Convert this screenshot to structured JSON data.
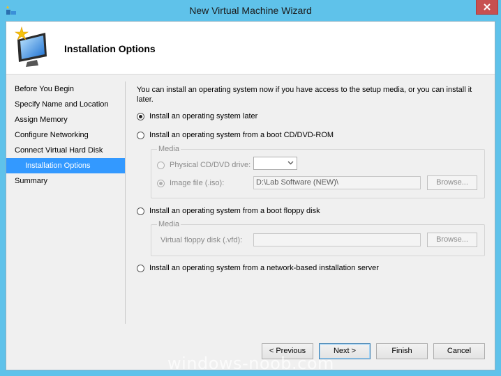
{
  "window": {
    "title": "New Virtual Machine Wizard",
    "icons": [
      "app-icon",
      "close-icon",
      "monitor-star-icon"
    ]
  },
  "header": {
    "title": "Installation Options"
  },
  "nav": {
    "items": [
      {
        "label": "Before You Begin",
        "selected": false
      },
      {
        "label": "Specify Name and Location",
        "selected": false
      },
      {
        "label": "Assign Memory",
        "selected": false
      },
      {
        "label": "Configure Networking",
        "selected": false
      },
      {
        "label": "Connect Virtual Hard Disk",
        "selected": false
      },
      {
        "label": "Installation Options",
        "selected": true
      },
      {
        "label": "Summary",
        "selected": false
      }
    ]
  },
  "content": {
    "intro_line1": "You can install an operating system now if you have access to the setup media, or you can install it",
    "intro_line2": "later.",
    "option_later": "Install an operating system later",
    "option_cd": "Install an operating system from a boot CD/DVD-ROM",
    "media_label": "Media",
    "physical_drive_label": "Physical CD/DVD drive:",
    "image_file_label": "Image file (.iso):",
    "image_file_value": "D:\\Lab Software (NEW)\\",
    "browse_label": "Browse...",
    "option_floppy": "Install an operating system from a boot floppy disk",
    "floppy_media_label": "Media",
    "floppy_disk_label": "Virtual floppy disk (.vfd):",
    "floppy_browse_label": "Browse...",
    "option_network": "Install an operating system from a network-based installation server",
    "selected_option": "later"
  },
  "buttons": {
    "previous": "< Previous",
    "next": "Next >",
    "finish": "Finish",
    "cancel": "Cancel"
  },
  "watermark": "windows-noob.com",
  "colors": {
    "frame": "#5fc2ea",
    "selection": "#3399ff",
    "close": "#c75050"
  }
}
